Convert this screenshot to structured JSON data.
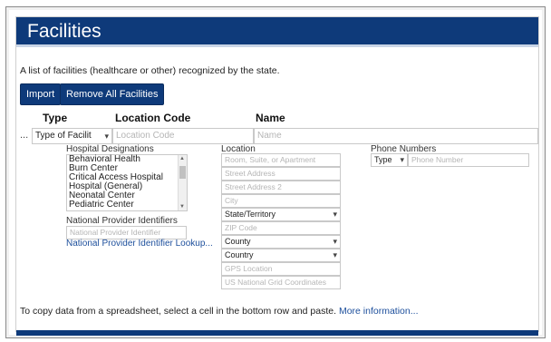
{
  "page": {
    "title": "Facilities",
    "description": "A list of facilities (healthcare or other) recognized by the state."
  },
  "toolbar": {
    "import_label": "Import",
    "remove_all_label": "Remove All Facilities"
  },
  "columns": {
    "type": "Type",
    "location_code": "Location Code",
    "name": "Name"
  },
  "row": {
    "ellipsis": "...",
    "type_value": "Type of Facilit",
    "location_code_placeholder": "Location Code",
    "name_placeholder": "Name"
  },
  "hospital_designations": {
    "label": "Hospital Designations",
    "items": [
      "Behavioral Health",
      "Burn Center",
      "Critical Access Hospital",
      "Hospital (General)",
      "Neonatal Center",
      "Pediatric Center"
    ]
  },
  "npi": {
    "label": "National Provider Identifiers",
    "placeholder": "National Provider Identifier",
    "lookup_link": "National Provider Identifier Lookup..."
  },
  "location": {
    "label": "Location",
    "room_placeholder": "Room, Suite, or Apartment",
    "street_placeholder": "Street Address",
    "street2_placeholder": "Street Address 2",
    "city_placeholder": "City",
    "state_value": "State/Territory",
    "zip_placeholder": "ZIP Code",
    "county_value": "County",
    "country_value": "Country",
    "gps_placeholder": "GPS Location",
    "usng_placeholder": "US National Grid Coordinates"
  },
  "phone": {
    "label": "Phone Numbers",
    "type_value": "Type",
    "number_placeholder": "Phone Number"
  },
  "footer": {
    "text": "To copy data from a spreadsheet, select a cell in the bottom row and paste.",
    "more_link": "More information..."
  },
  "colors": {
    "primary": "#0e3a7a",
    "link": "#1d4f9c"
  }
}
